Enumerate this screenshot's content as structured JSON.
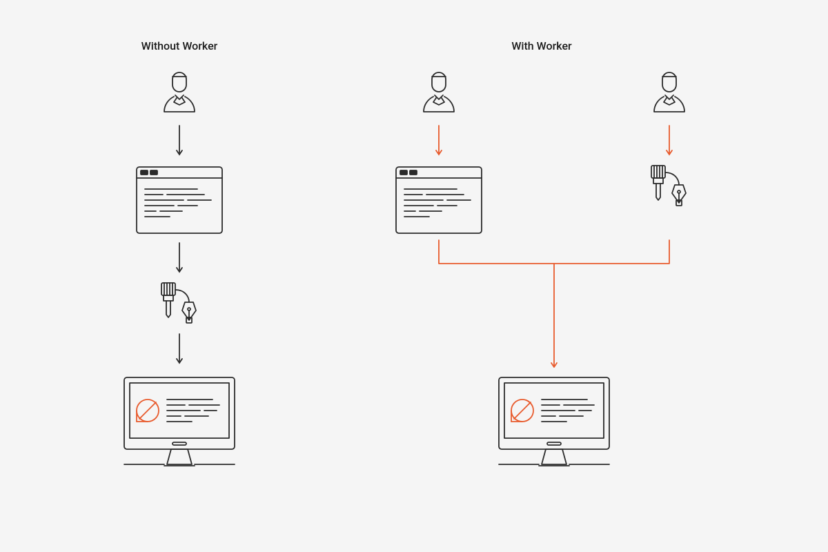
{
  "left": {
    "title": "Without Worker",
    "nodes": [
      "user-icon",
      "code-window-icon",
      "tools-icon",
      "monitor-icon"
    ],
    "arrow_color": "#2b2b2b"
  },
  "right": {
    "title": "With Worker",
    "nodes_top": [
      "user-icon",
      "user-icon"
    ],
    "nodes_mid": [
      "code-window-icon",
      "tools-icon"
    ],
    "node_bottom": "monitor-icon",
    "arrow_color": "#e85a2c"
  },
  "colors": {
    "stroke": "#2b2b2b",
    "accent": "#e85a2c",
    "bg": "#f5f5f5"
  }
}
